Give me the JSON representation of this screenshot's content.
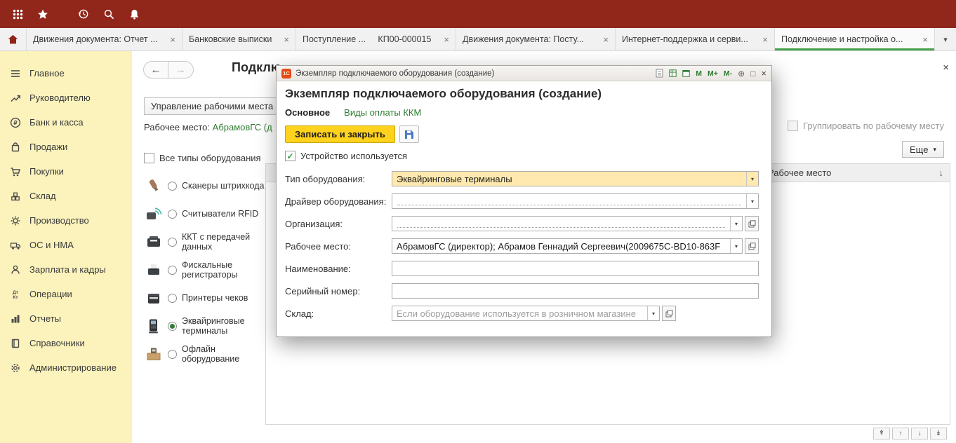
{
  "colors": {
    "topbar": "#91261A",
    "sidebar": "#FBF2BC",
    "link_green": "#2F7D31",
    "active_tab_underline": "#43A047",
    "primary_button": "#FFD21E",
    "highlighted_field": "#FFE9AE",
    "dialog_logo": "#E64A19"
  },
  "ui": {
    "close": "×",
    "dropdown": "▾",
    "back_arrow": "←",
    "forward_arrow": "→",
    "sort_desc": "↓",
    "check": "✓",
    "zoom_plus": "⊕",
    "maximize": "□",
    "pager_top": "↟",
    "pager_up": "↑",
    "pager_down": "↓",
    "pager_bottom": "↡"
  },
  "tabs": [
    {
      "label": "Движения документа: Отчет ..."
    },
    {
      "label": "Банковские выписки"
    },
    {
      "label": "Поступление ...     КП00-000015"
    },
    {
      "label": "Движения документа: Посту..."
    },
    {
      "label": "Интернет-поддержка и серви..."
    },
    {
      "label": "Подключение и настройка о...",
      "active": true
    }
  ],
  "sidebar": {
    "items": [
      {
        "label": "Главное",
        "icon": "main-menu-icon"
      },
      {
        "label": "Руководителю",
        "icon": "manager-trend-icon"
      },
      {
        "label": "Банк и касса",
        "icon": "bank-cash-icon"
      },
      {
        "label": "Продажи",
        "icon": "sales-icon"
      },
      {
        "label": "Покупки",
        "icon": "purchases-icon"
      },
      {
        "label": "Склад",
        "icon": "warehouse-icon"
      },
      {
        "label": "Производство",
        "icon": "production-icon"
      },
      {
        "label": "ОС и НМА",
        "icon": "fixed-assets-icon"
      },
      {
        "label": "Зарплата и кадры",
        "icon": "payroll-hr-icon"
      },
      {
        "label": "Операции",
        "icon": "operations-dtkt-icon"
      },
      {
        "label": "Отчеты",
        "icon": "reports-icon"
      },
      {
        "label": "Справочники",
        "icon": "catalogs-icon"
      },
      {
        "label": "Администрирование",
        "icon": "administration-icon"
      }
    ]
  },
  "main": {
    "title": "Подклю",
    "workplaces_button": "Управление рабочими места",
    "workplace_label": "Рабочее место:",
    "workplace_link": "АбрамовГС (д",
    "all_types_label": "Все типы оборудования",
    "equipment": [
      {
        "label": "Сканеры штрихкода",
        "selected": false
      },
      {
        "label": "Считыватели RFID",
        "selected": false
      },
      {
        "label": "ККТ с передачей данных",
        "selected": false
      },
      {
        "label": "Фискальные регистраторы",
        "selected": false
      },
      {
        "label": "Принтеры чеков",
        "selected": false
      },
      {
        "label": "Эквайринговые терминалы",
        "selected": true
      },
      {
        "label": "Офлайн оборудование",
        "selected": false
      }
    ],
    "group_by_workplace_label": "Группировать по рабочему месту",
    "more_button": "Еще",
    "table_header": "Рабочее место"
  },
  "dialog": {
    "window_title": "Экземпляр подключаемого оборудования (создание)",
    "heading": "Экземпляр подключаемого оборудования (создание)",
    "memory": [
      "M",
      "M+",
      "M-"
    ],
    "tab_main": "Основное",
    "tab_payments": "Виды оплаты ККМ",
    "save_close_button": "Записать и закрыть",
    "device_used_label": "Устройство используется",
    "fields": [
      {
        "label": "Тип оборудования:",
        "value": "Эквайринговые терминалы"
      },
      {
        "label": "Драйвер оборудования:",
        "value": ""
      },
      {
        "label": "Организация:",
        "value": ""
      },
      {
        "label": "Рабочее место:",
        "value": "АбрамовГС (директор); Абрамов Геннадий Сергеевич(2009675C-BD10-863F"
      },
      {
        "label": "Наименование:",
        "value": ""
      },
      {
        "label": "Серийный номер:",
        "value": ""
      },
      {
        "label": "Склад:",
        "value": "",
        "placeholder": "Если оборудование используется в розничном магазине"
      }
    ]
  }
}
